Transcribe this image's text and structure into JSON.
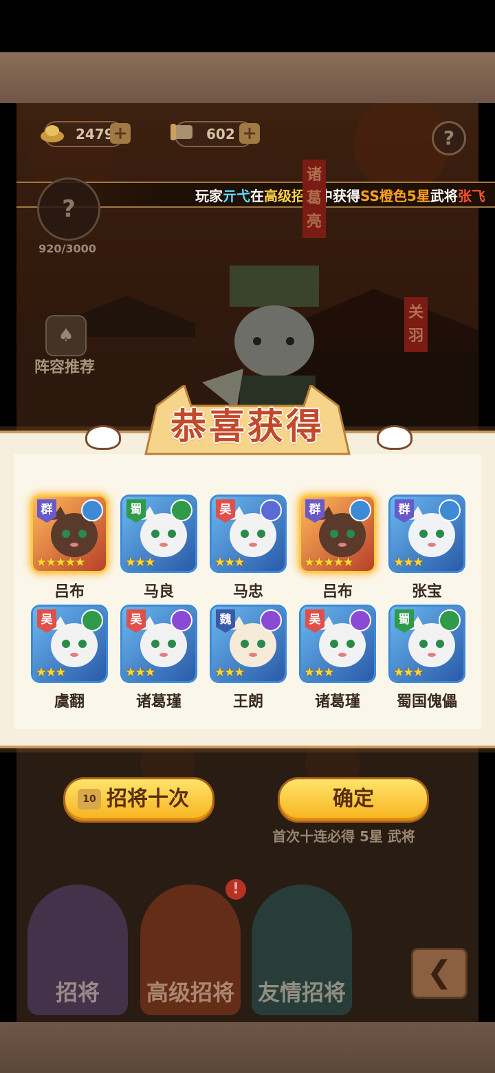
{
  "resources": {
    "gold": "24794",
    "scroll": "602",
    "plus": "+"
  },
  "help": "?",
  "ticker": {
    "prefix": "玩家",
    "player": "亓弋",
    "mid1": "在",
    "pool": "高级招将",
    "mid2": "中获得",
    "grade": "SS橙色5星",
    "mid3": "武将",
    "hero": "张飞"
  },
  "orb": {
    "icon": "?",
    "count": "920/3000"
  },
  "lineup": {
    "label": "阵容推荐"
  },
  "banners": {
    "left": "诸葛亮",
    "right": "关羽"
  },
  "modal": {
    "title": "恭喜获得",
    "heroes": [
      {
        "name": "吕布",
        "faction": "群",
        "stars": 5,
        "rarity": "gold"
      },
      {
        "name": "马良",
        "faction": "蜀",
        "stars": 3,
        "rarity": "blue"
      },
      {
        "name": "马忠",
        "faction": "吴",
        "stars": 3,
        "rarity": "blue"
      },
      {
        "name": "吕布",
        "faction": "群",
        "stars": 5,
        "rarity": "gold"
      },
      {
        "name": "张宝",
        "faction": "群",
        "stars": 3,
        "rarity": "blue"
      },
      {
        "name": "虞翻",
        "faction": "吴",
        "stars": 3,
        "rarity": "blue"
      },
      {
        "name": "诸葛瑾",
        "faction": "吴",
        "stars": 3,
        "rarity": "blue"
      },
      {
        "name": "王朗",
        "faction": "魏",
        "stars": 3,
        "rarity": "blue"
      },
      {
        "name": "诸葛瑾",
        "faction": "吴",
        "stars": 3,
        "rarity": "blue"
      },
      {
        "name": "蜀国傀儡",
        "faction": "蜀",
        "stars": 3,
        "rarity": "blue"
      }
    ]
  },
  "buttons": {
    "recruit_ten": "招将十次",
    "recruit_badge": "10",
    "confirm": "确定"
  },
  "note": "首次十连必得 5星 武将",
  "tabs": [
    {
      "label": "招将"
    },
    {
      "label": "高级招将"
    },
    {
      "label": "友情招将"
    }
  ],
  "notif": "!",
  "colors": {
    "accent": "#f7b21e",
    "title": "#c24a2a",
    "panel": "#f7efde"
  }
}
